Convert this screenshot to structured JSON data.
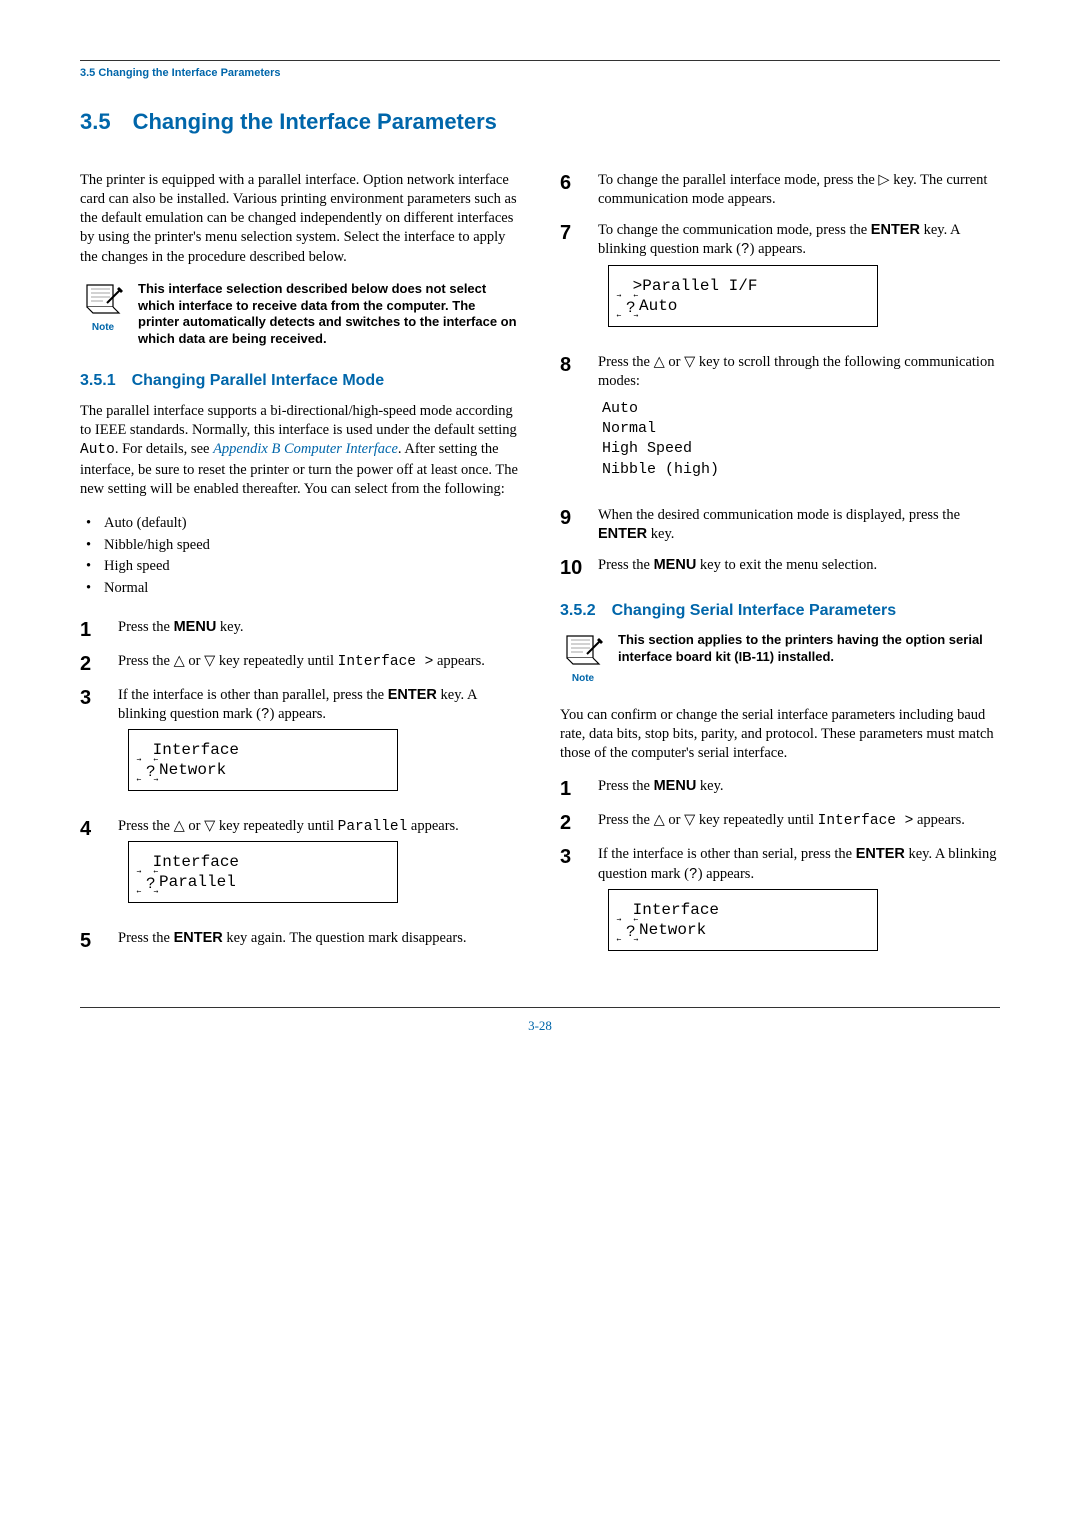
{
  "runningHead": "3.5 Changing the Interface Parameters",
  "h1": "3.5 Changing the Interface Parameters",
  "intro": "The printer is equipped with a parallel interface. Option network interface card can also be installed. Various printing environment parameters such as the default emulation can be changed independently on different interfaces by using the printer's menu selection system. Select the interface to apply the changes in the procedure described below.",
  "noteLabel": "Note",
  "note1": "This interface selection described below does not select which interface to receive data from the computer. The printer automatically detects and switches to the interface on which data are being received.",
  "h2a": "3.5.1 Changing Parallel Interface Mode",
  "paraA1a": "The parallel interface supports a bi-directional/high-speed mode according to IEEE standards. Normally, this interface is used under the default setting ",
  "paraA1auto": "Auto",
  "paraA1b": ". For details, see ",
  "paraA1link": "Appendix B Computer Interface",
  "paraA1c": ". After setting the interface, be sure to reset the printer or turn the power off at least once. The new setting will be enabled thereafter. You can select from the following:",
  "bulletsA": [
    "Auto (default)",
    "Nibble/high speed",
    "High speed",
    "Normal"
  ],
  "steps": {
    "s1a": "Press the ",
    "s1b": "MENU",
    "s1c": " key.",
    "s2a": "Press the ",
    "s2b": " or ",
    "s2c": " key repeatedly until ",
    "s2d": "Interface >",
    "s2e": " appears.",
    "s3a": "If the interface is other than parallel, press the ",
    "s3b": "ENTER",
    "s3c": " key. A blinking question mark (",
    "s3q": "?",
    "s3d": ") appears.",
    "lcd1l1": "Interface",
    "lcd1l2": " Network",
    "s4a": "Press the ",
    "s4b": " or ",
    "s4c": " key repeatedly until ",
    "s4d": "Parallel",
    "s4e": " appears.",
    "lcd2l1": "Interface",
    "lcd2l2": " Parallel",
    "s5a": "Press the ",
    "s5b": "ENTER",
    "s5c": " key again. The question mark disappears.",
    "s6a": "To change the parallel interface mode, press the ",
    "s6b": " key. The current communication mode appears.",
    "s7a": "To change the communication mode, press the ",
    "s7b": "ENTER",
    "s7c": " key. A blinking question mark (",
    "s7q": "?",
    "s7d": ") appears.",
    "lcd3l1": ">Parallel I/F",
    "lcd3l2": " Auto",
    "s8a": "Press the ",
    "s8b": " or ",
    "s8c": " key to scroll through the following communication modes:",
    "code": "Auto\nNormal\nHigh Speed\nNibble (high)",
    "s9a": "When the desired communication mode is displayed, press the ",
    "s9b": "ENTER",
    "s9c": " key.",
    "s10a": "Press the ",
    "s10b": "MENU",
    "s10c": " key to exit the menu selection."
  },
  "h2b": "3.5.2 Changing Serial Interface Parameters",
  "note2": "This section applies to the printers having the option serial interface board kit (IB-11) installed.",
  "paraB1": "You can confirm or change the serial interface parameters including baud rate, data bits, stop bits, parity, and protocol. These parameters must match those of the computer's serial interface.",
  "stepsB": {
    "s1a": "Press the ",
    "s1b": "MENU",
    "s1c": " key.",
    "s2a": "Press the ",
    "s2b": " or ",
    "s2c": " key repeatedly until ",
    "s2d": "Interface >",
    "s2e": " appears.",
    "s3a": "If the interface is other than serial, press the ",
    "s3b": "ENTER",
    "s3c": " key. A blinking question mark (",
    "s3q": "?",
    "s3d": ") appears.",
    "lcd4l1": "Interface",
    "lcd4l2": " Network"
  },
  "footer": "3-28",
  "nums": {
    "n1": "1",
    "n2": "2",
    "n3": "3",
    "n4": "4",
    "n5": "5",
    "n6": "6",
    "n7": "7",
    "n8": "8",
    "n9": "9",
    "n10": "10"
  },
  "tri": {
    "up": "△",
    "down": "▽",
    "right": "▷"
  },
  "q": "?"
}
